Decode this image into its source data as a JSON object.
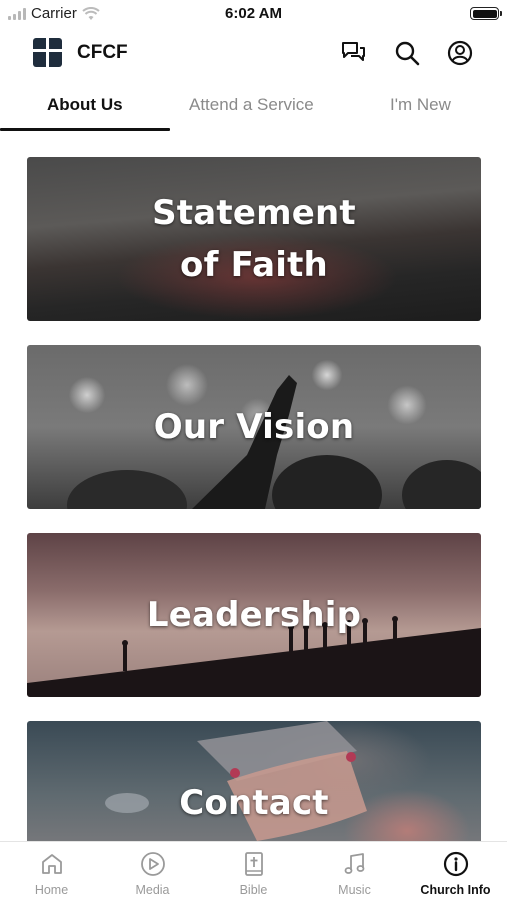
{
  "status_bar": {
    "carrier": "Carrier",
    "time": "6:02 AM"
  },
  "header": {
    "title": "CFCF",
    "icons": [
      "chat-icon",
      "search-icon",
      "account-icon"
    ]
  },
  "tabs": [
    {
      "label": "About Us",
      "active": true
    },
    {
      "label": "Attend a Service",
      "active": false
    },
    {
      "label": "I'm New",
      "active": false
    }
  ],
  "cards": [
    {
      "title": "Statement\nof Faith"
    },
    {
      "title": "Our Vision"
    },
    {
      "title": "Leadership"
    },
    {
      "title": "Contact"
    }
  ],
  "bottom_nav": [
    {
      "label": "Home",
      "icon": "home-icon",
      "active": false
    },
    {
      "label": "Media",
      "icon": "play-icon",
      "active": false
    },
    {
      "label": "Bible",
      "icon": "bible-icon",
      "active": false
    },
    {
      "label": "Music",
      "icon": "music-icon",
      "active": false
    },
    {
      "label": "Church Info",
      "icon": "info-icon",
      "active": true
    }
  ],
  "colors": {
    "active": "#111111",
    "inactive": "#9a9a9a",
    "divider": "#e4e4e4"
  }
}
